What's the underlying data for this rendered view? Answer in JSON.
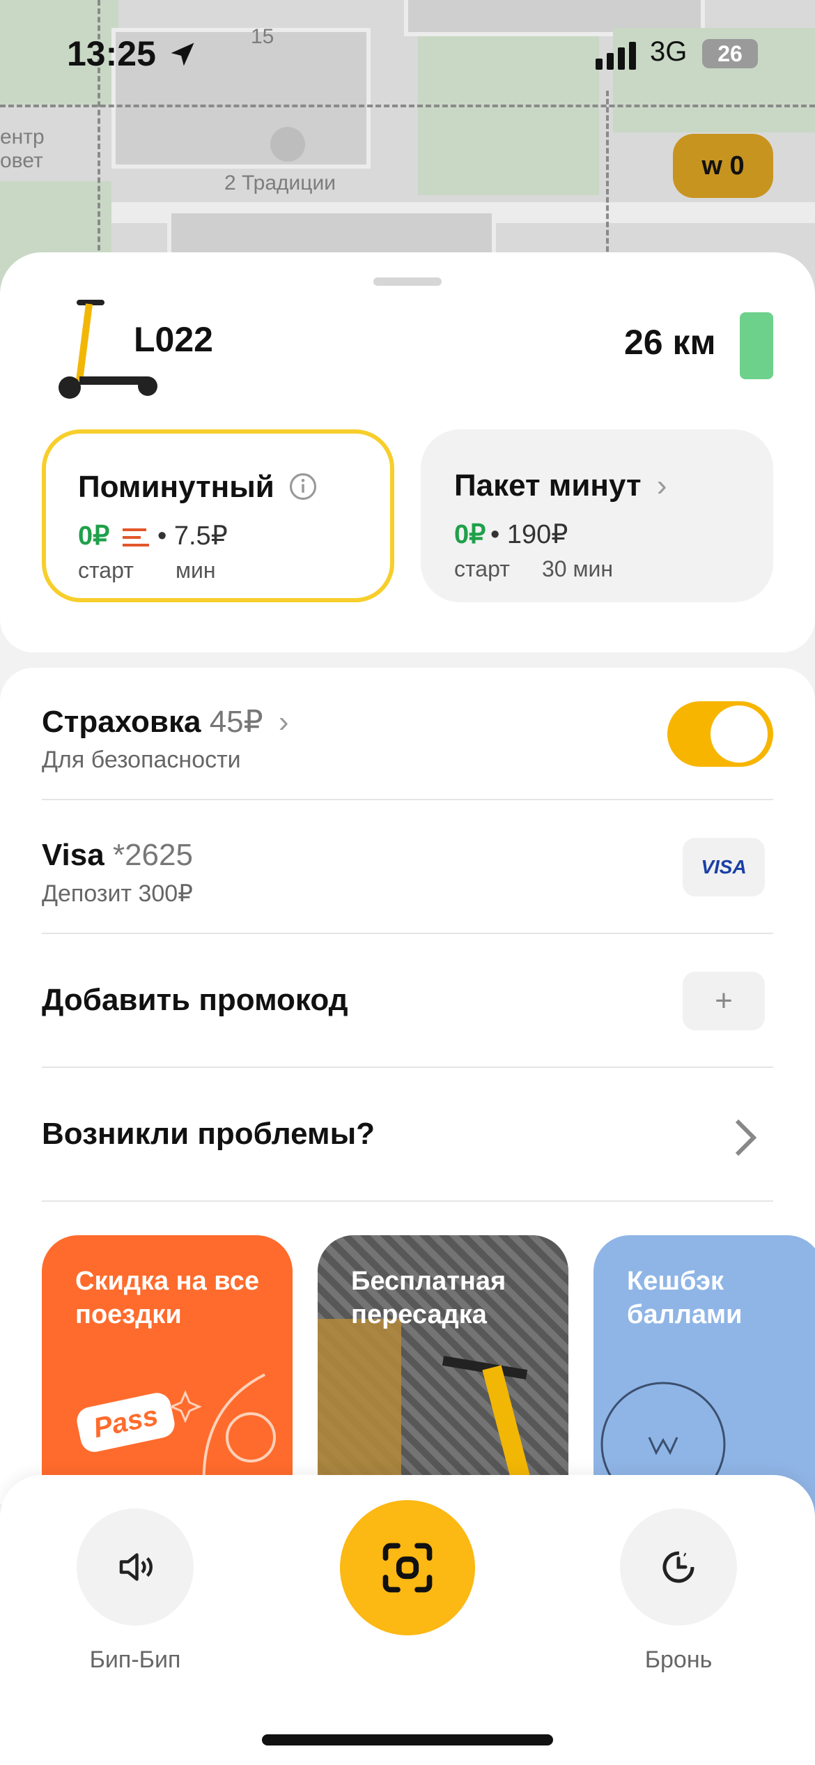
{
  "status_bar": {
    "time": "13:25",
    "network": "3G",
    "battery": "26"
  },
  "map": {
    "labels": {
      "building_number": "15",
      "poi_name": "2 Традиции",
      "edge_top": "ентр",
      "edge_bottom": "овет"
    },
    "coin_balance": "0"
  },
  "scooter": {
    "id": "L022",
    "range": "26 км"
  },
  "tariffs": [
    {
      "name": "Поминутный",
      "start_price": "0₽",
      "per_min_price": "• 7.5₽",
      "start_caption": "старт",
      "unit_caption": "мин",
      "selected": true
    },
    {
      "name": "Пакет минут",
      "start_price": "0₽",
      "package_price": "• 190₽",
      "start_caption": "старт",
      "unit_caption": "30 мин",
      "selected": false
    }
  ],
  "insurance": {
    "title": "Страховка",
    "price": "45₽",
    "subtitle": "Для безопасности",
    "enabled": true
  },
  "payment": {
    "title": "Visa",
    "card_mask": "*2625",
    "subtitle": "Депозит 300₽",
    "brand": "VISA"
  },
  "promo": {
    "title": "Добавить промокод",
    "action": "+"
  },
  "problems": {
    "title": "Возникли проблемы?"
  },
  "cards": [
    {
      "label": "Скидка на все поездки",
      "badge": "Pass",
      "color": "#ff6b2c"
    },
    {
      "label": "Бесплатная пересадка",
      "color": "#3a3a3a"
    },
    {
      "label": "Кешбэк баллами",
      "color": "#8fb5e6"
    }
  ],
  "bottom_bar": {
    "beep_label": "Бип-Бип",
    "booking_label": "Бронь"
  },
  "colors": {
    "accent": "#fcb813",
    "selected_border": "#f7ce2b",
    "green_price": "#1fa04a",
    "battery_green": "#6dd18b"
  }
}
